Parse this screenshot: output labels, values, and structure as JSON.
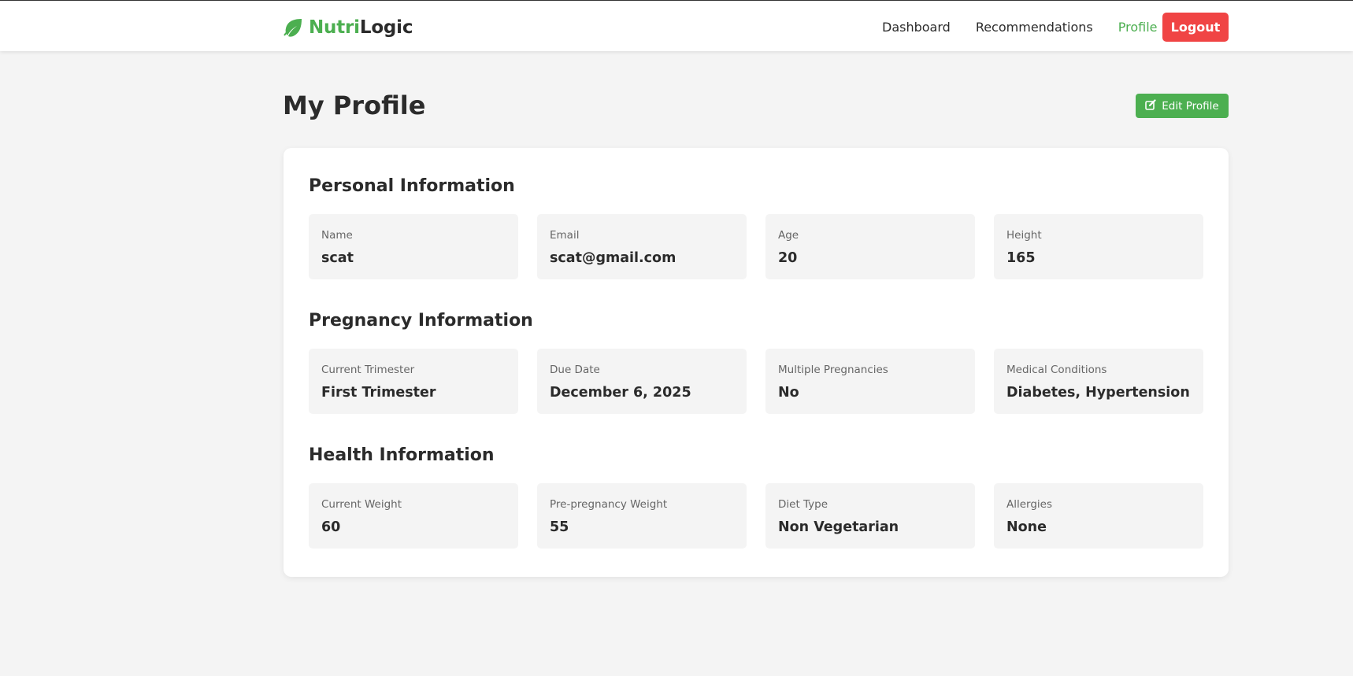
{
  "brand": {
    "part1": "Nutri",
    "part2": "Logic",
    "icon": "leaf-icon"
  },
  "nav": {
    "links": [
      "Dashboard",
      "Recommendations",
      "Profile"
    ],
    "active": "Profile",
    "logout_label": "Logout"
  },
  "page": {
    "title": "My Profile",
    "edit_label": "Edit Profile",
    "edit_icon": "edit-icon"
  },
  "sections": [
    {
      "title": "Personal Information",
      "fields": [
        {
          "label": "Name",
          "value": "scat"
        },
        {
          "label": "Email",
          "value": "scat@gmail.com"
        },
        {
          "label": "Age",
          "value": "20"
        },
        {
          "label": "Height",
          "value": "165"
        }
      ]
    },
    {
      "title": "Pregnancy Information",
      "fields": [
        {
          "label": "Current Trimester",
          "value": "First Trimester"
        },
        {
          "label": "Due Date",
          "value": "December 6, 2025"
        },
        {
          "label": "Multiple Pregnancies",
          "value": "No"
        },
        {
          "label": "Medical Conditions",
          "value": "Diabetes, Hypertension"
        }
      ]
    },
    {
      "title": "Health Information",
      "fields": [
        {
          "label": "Current Weight",
          "value": "60"
        },
        {
          "label": "Pre-pregnancy Weight",
          "value": "55"
        },
        {
          "label": "Diet Type",
          "value": "Non Vegetarian"
        },
        {
          "label": "Allergies",
          "value": "None"
        }
      ]
    }
  ],
  "colors": {
    "accent": "#4caf50",
    "danger": "#f04444",
    "background": "#f4f4f4",
    "text": "#2b2b2b"
  }
}
